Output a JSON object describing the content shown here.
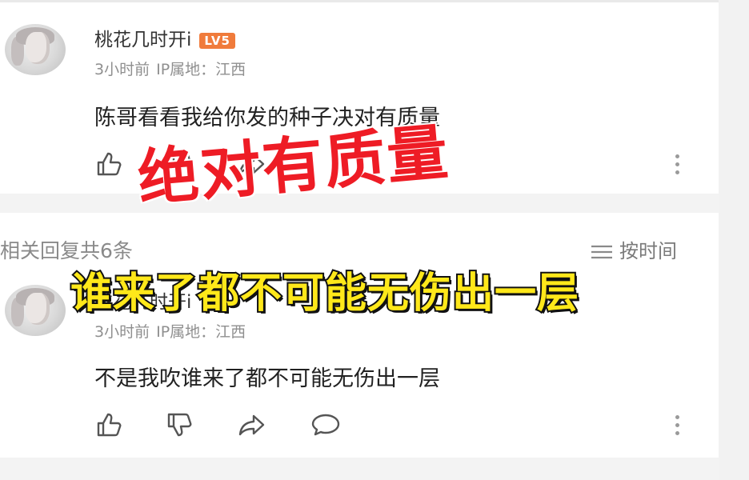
{
  "comment1": {
    "username": "桃花几时开i",
    "level": "LV5",
    "time": "3小时前",
    "ip_label": "IP属地：江西",
    "text": "陈哥看看我给你发的种子决对有质量"
  },
  "replies_header": {
    "count_text": "相关回复共6条",
    "sort_label": "按时间"
  },
  "comment2": {
    "username": "桃花几时开i",
    "time": "3小时前",
    "ip_label": "IP属地：江西",
    "text": "不是我吹谁来了都不可能无伤出一层"
  },
  "overlays": {
    "red_caption": "绝对有质量",
    "yellow_caption": "谁来了都不可能无伤出一层"
  },
  "colors": {
    "level_badge": "#f07b3b",
    "red_caption": "#ee1c25",
    "yellow_caption": "#ffe81a"
  },
  "icons": [
    "like-icon",
    "dislike-icon",
    "share-icon",
    "reply-icon",
    "more-icon",
    "sort-icon"
  ]
}
